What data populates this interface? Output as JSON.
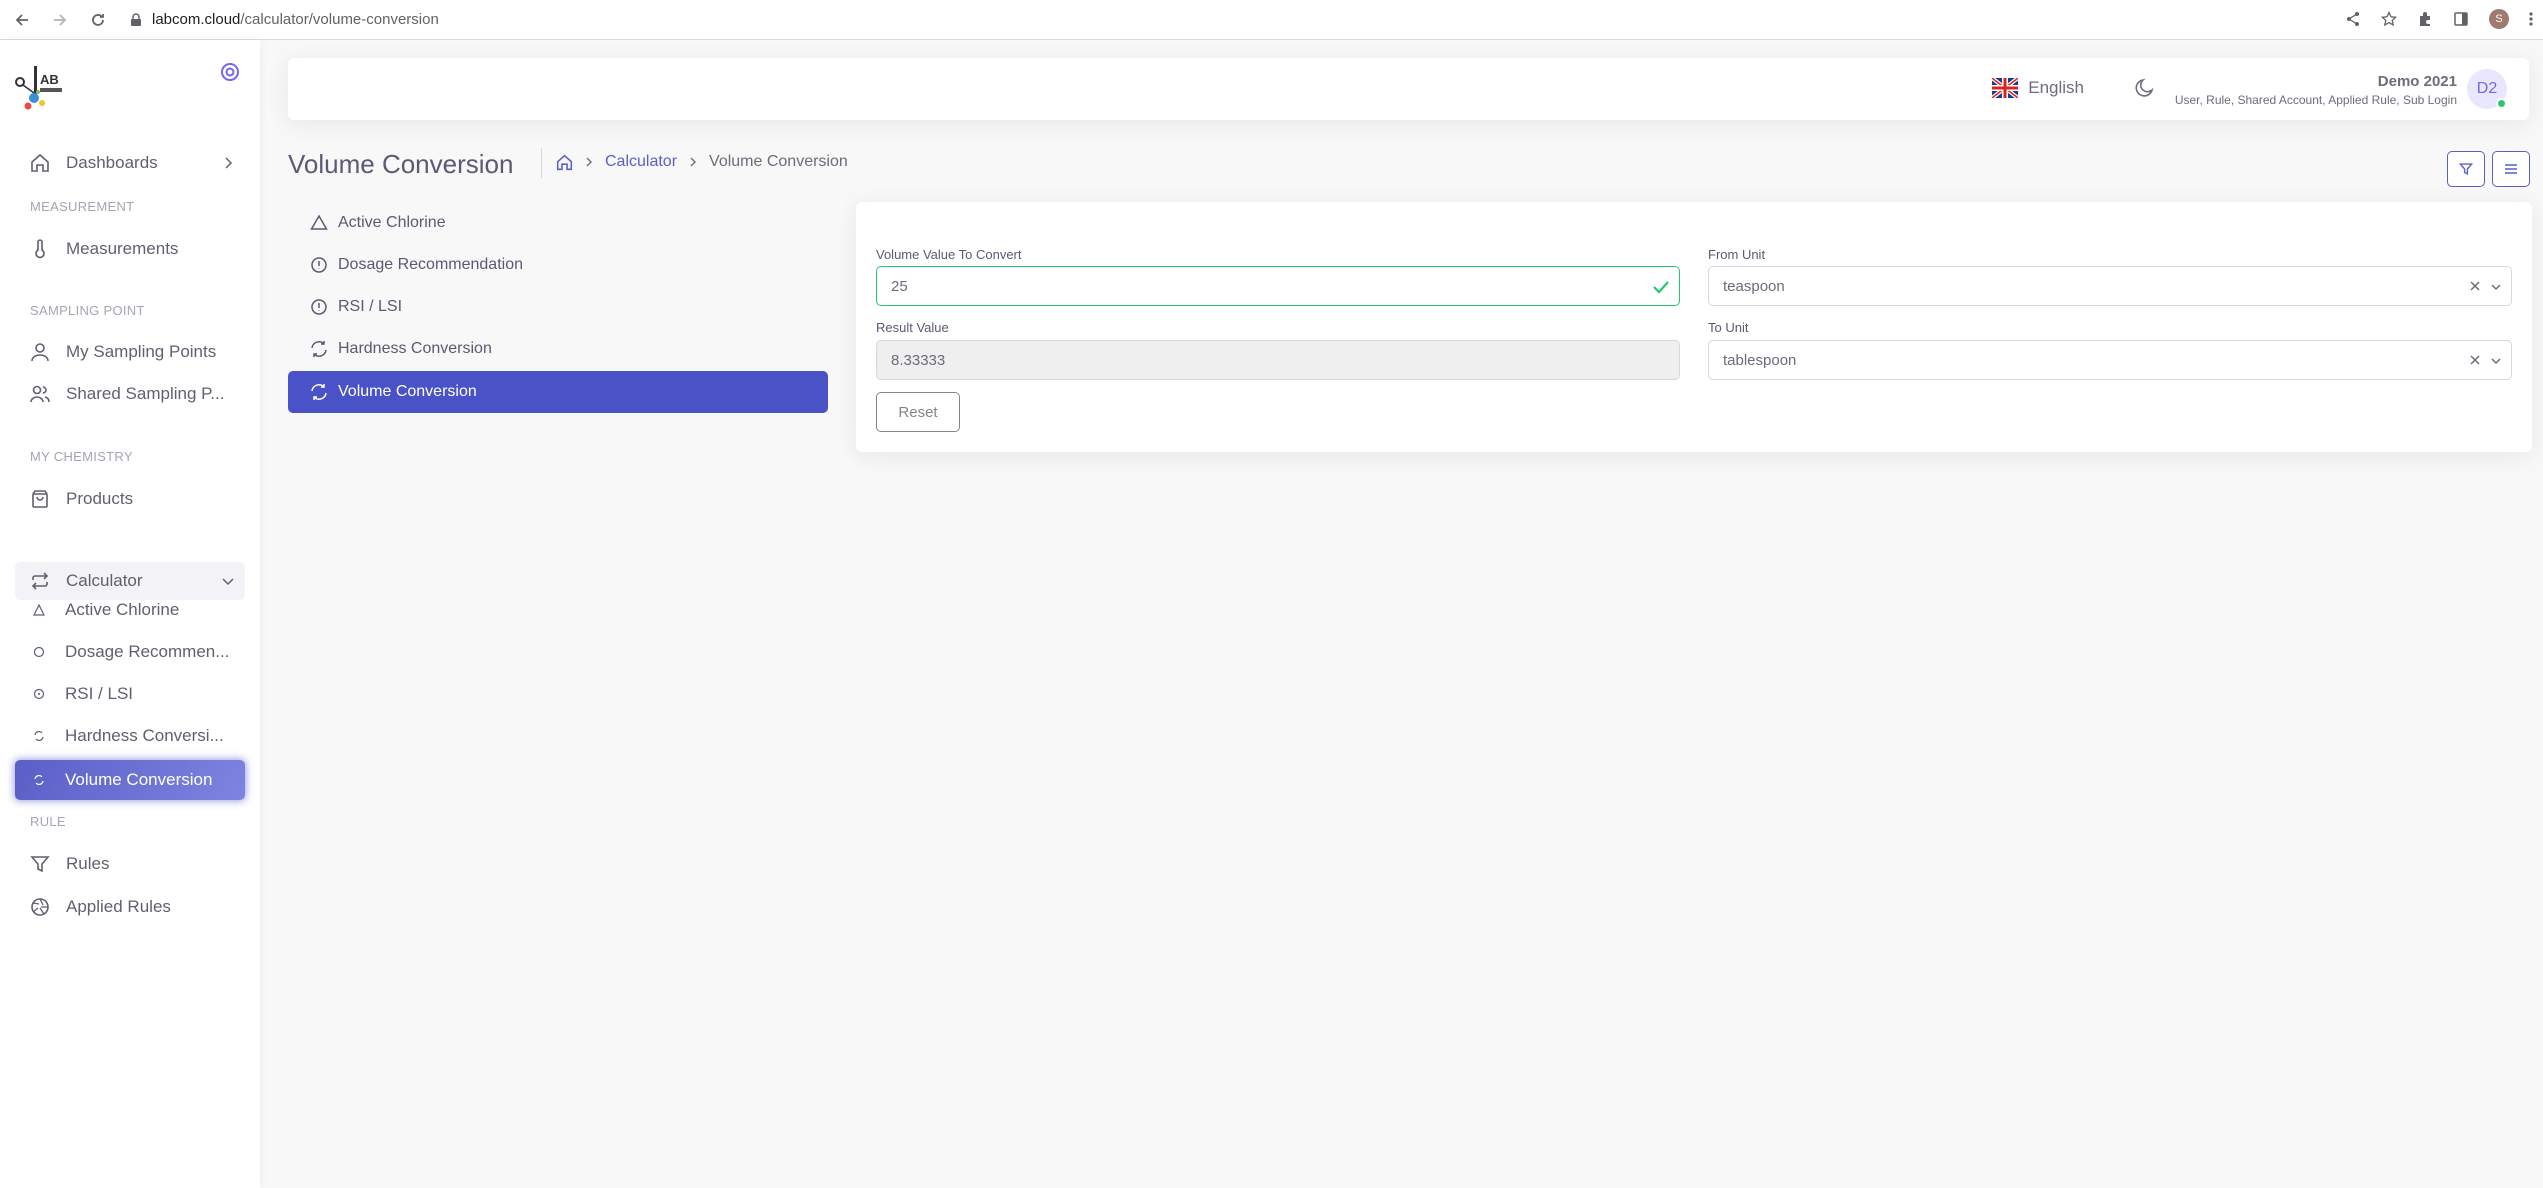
{
  "browser": {
    "url_domain": "labcom.cloud",
    "url_path": "/calculator/volume-conversion",
    "profile_initial": "S"
  },
  "sidebar": {
    "items": {
      "dashboards": "Dashboards",
      "measurements": "Measurements",
      "my_sampling_points": "My Sampling Points",
      "shared_sampling_points": "Shared Sampling P...",
      "products": "Products",
      "calculator": "Calculator",
      "active_chlorine": "Active Chlorine",
      "dosage_recommendation": "Dosage Recommen...",
      "rsi_lsi": "RSI / LSI",
      "hardness_conversion": "Hardness Conversi...",
      "volume_conversion": "Volume Conversion",
      "rules": "Rules",
      "applied_rules": "Applied Rules"
    },
    "headers": {
      "measurement": "MEASUREMENT",
      "sampling_point": "SAMPLING POINT",
      "my_chemistry": "MY CHEMISTRY",
      "rule": "RULE"
    }
  },
  "navbar": {
    "language": "English",
    "user_name": "Demo 2021",
    "user_roles": "User, Rule, Shared Account, Applied Rule, Sub Login",
    "avatar_initials": "D2"
  },
  "page": {
    "title": "Volume Conversion",
    "breadcrumb": {
      "calculator": "Calculator",
      "current": "Volume Conversion"
    }
  },
  "calc_menu": {
    "active_chlorine": "Active Chlorine",
    "dosage_recommendation": "Dosage Recommendation",
    "rsi_lsi": "RSI / LSI",
    "hardness_conversion": "Hardness Conversion",
    "volume_conversion": "Volume Conversion"
  },
  "form": {
    "volume_label": "Volume Value To Convert",
    "volume_value": "25",
    "from_unit_label": "From Unit",
    "from_unit_value": "teaspoon",
    "result_label": "Result Value",
    "result_value": "8.33333",
    "to_unit_label": "To Unit",
    "to_unit_value": "tablespoon",
    "reset_label": "Reset"
  },
  "colors": {
    "primary": "#5a5fc7",
    "active_menu": "#4a52c8",
    "success": "#28c76f"
  }
}
